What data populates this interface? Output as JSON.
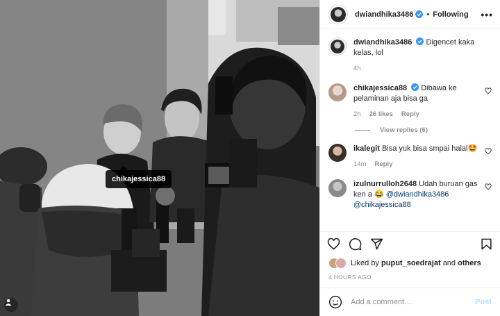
{
  "header": {
    "username": "dwiandhika3486",
    "separator": "•",
    "follow_label": "Following",
    "more_label": "•••"
  },
  "photo": {
    "tag_label": "chikajessica88"
  },
  "caption": {
    "username": "dwiandhika3486",
    "text": "Digencet kaka kelas, lol",
    "time": "4h"
  },
  "comments": [
    {
      "username": "chikajessica88",
      "verified": true,
      "text": "Dibawa ke pelaminan aja bisa ga",
      "time": "2h",
      "likes": "26 likes",
      "reply_label": "Reply"
    },
    {
      "username": "ikalegit",
      "text": "Bisa yuk bisa smpai halal🤩",
      "time": "14m",
      "reply_label": "Reply"
    },
    {
      "username": "izulnurrulloh2648",
      "text": "Udah buruan gas ken a 😂",
      "mention1": "@dwiandhika3486",
      "mention2": "@chikajessica88"
    }
  ],
  "view_replies_label": "View replies (6)",
  "likes": {
    "prefix": "Liked by",
    "user": "puput_soedrajat",
    "and": "and",
    "others": "others"
  },
  "timestamp": "4 HOURS AGO",
  "add_comment": {
    "placeholder": "Add a comment…",
    "post_label": "Post"
  },
  "colors": {
    "verified": "#3897f0",
    "mention": "#00376b",
    "post_disabled": "#b2dffc",
    "muted": "#8e8e8e"
  }
}
